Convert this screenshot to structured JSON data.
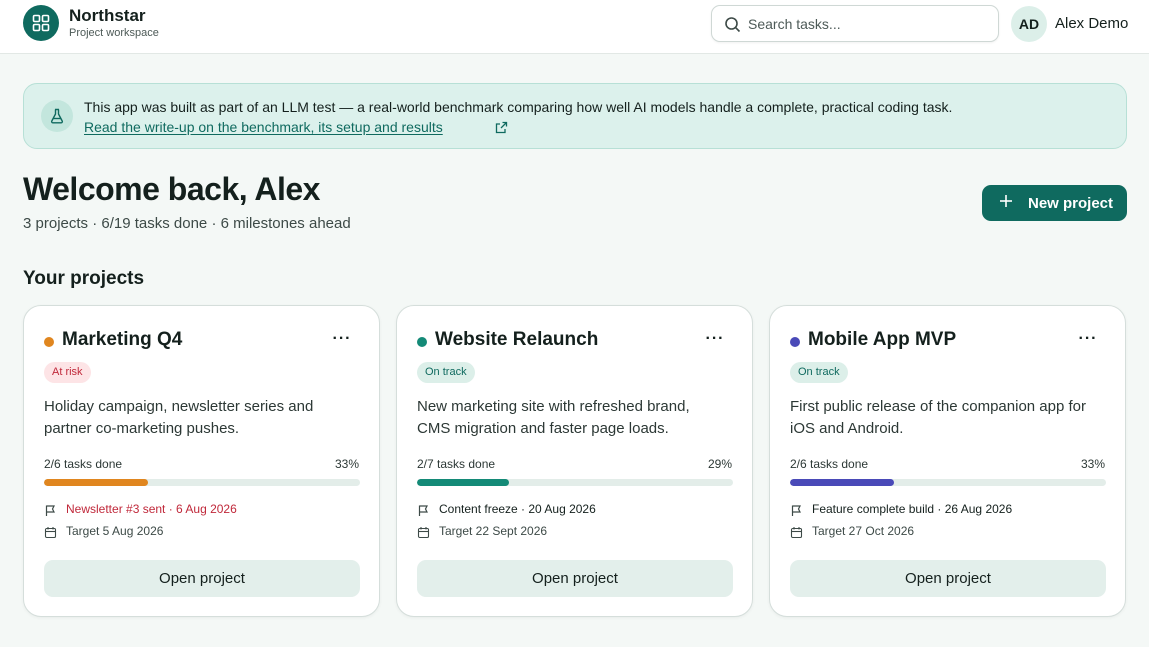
{
  "header": {
    "brand_name": "Northstar",
    "brand_sub": "Project workspace",
    "search_placeholder": "Search tasks...",
    "avatar_initials": "AD",
    "user_name": "Alex Demo"
  },
  "banner": {
    "text": "This app was built as part of an LLM test — a real-world benchmark comparing how well AI models handle a complete, practical coding task.",
    "link": "Read the write-up on the benchmark, its setup and results"
  },
  "welcome": {
    "title": "Welcome back, Alex",
    "summary": "3 projects · 6/19 tasks done · 6 milestones ahead",
    "new_project_label": "New project"
  },
  "section_title": "Your projects",
  "projects": [
    {
      "name": "Marketing Q4",
      "status": "At risk",
      "description": "Holiday campaign, newsletter series and partner co-marketing pushes.",
      "tasks_label": "2/6 tasks done",
      "percent_label": "33%",
      "progress": 0.33,
      "milestone": "Newsletter #3 sent · 6 Aug 2026",
      "target": "Target 5 Aug 2026",
      "open_label": "Open project"
    },
    {
      "name": "Website Relaunch",
      "status": "On track",
      "description": "New marketing site with refreshed brand, CMS migration and faster page loads.",
      "tasks_label": "2/7 tasks done",
      "percent_label": "29%",
      "progress": 0.29,
      "milestone": "Content freeze · 20 Aug 2026",
      "target": "Target 22 Sept 2026",
      "open_label": "Open project"
    },
    {
      "name": "Mobile App MVP",
      "status": "On track",
      "description": "First public release of the companion app for iOS and Android.",
      "tasks_label": "2/6 tasks done",
      "percent_label": "33%",
      "progress": 0.33,
      "milestone": "Feature complete build · 26 Aug 2026",
      "target": "Target 27 Oct 2026",
      "open_label": "Open project"
    }
  ],
  "colors": {
    "brand": "#0f6a5f",
    "at_risk_text": "#c0283a",
    "at_risk_bg": "#fde4e6",
    "on_track_text": "#0f6a5f",
    "on_track_bg": "#dcefe9",
    "marketing": "#e0861f",
    "website": "#148a77",
    "mobile": "#4a4ab8"
  },
  "icons": {
    "brand": "grid-icon",
    "search": "search-icon",
    "banner": "flask-icon",
    "external": "external-link-icon",
    "new": "plus-icon",
    "milestone": "flag-icon",
    "target": "calendar-icon",
    "menu": "more-horizontal-icon"
  }
}
